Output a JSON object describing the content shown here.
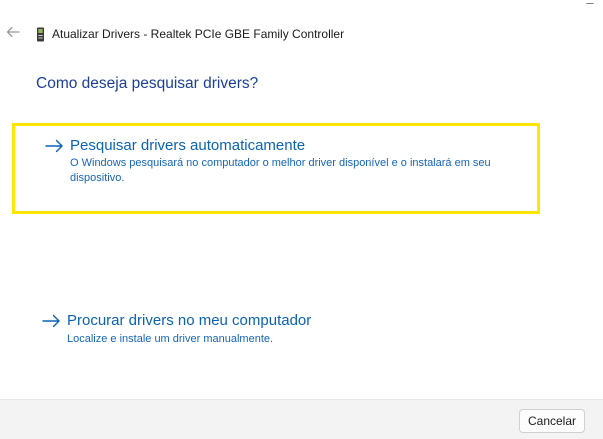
{
  "window": {
    "title": "Atualizar Drivers - Realtek PCIe GBE Family Controller"
  },
  "question": "Como deseja pesquisar drivers?",
  "options": [
    {
      "title": "Pesquisar drivers automaticamente",
      "description": "O Windows pesquisará no computador o melhor driver disponível e o instalará em seu dispositivo.",
      "highlighted": true,
      "highlight_color": "#ffe600"
    },
    {
      "title": "Procurar drivers no meu computador",
      "description": "Localize e instale um driver manualmente.",
      "highlighted": false
    }
  ],
  "footer": {
    "cancel_label": "Cancelar"
  },
  "icons": {
    "back": "back-arrow-icon",
    "device": "network-adapter-icon",
    "option_arrow": "right-arrow-icon"
  },
  "colors": {
    "question_text": "#1c3f94",
    "link_text": "#0a63b5",
    "footer_bg": "#f3f3f3"
  }
}
